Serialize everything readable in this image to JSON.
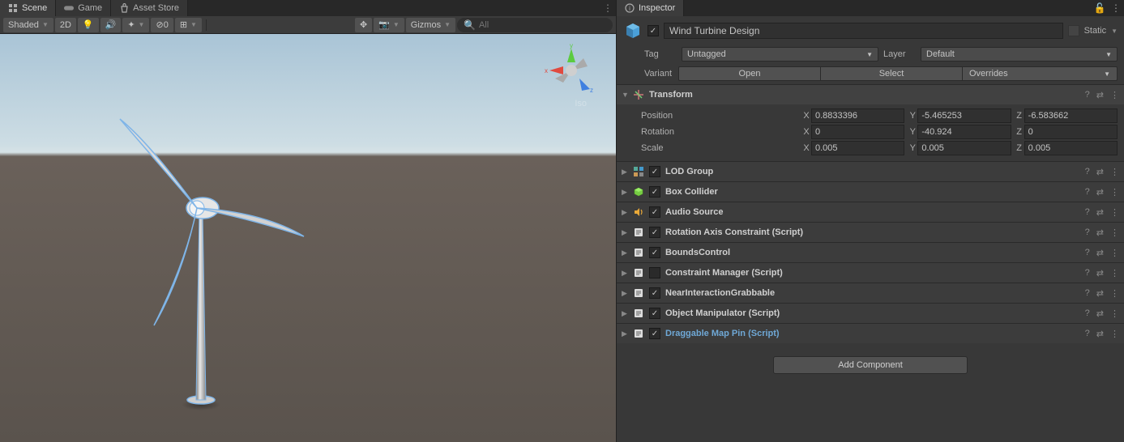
{
  "leftTabs": {
    "scene": "Scene",
    "game": "Game",
    "asset": "Asset Store"
  },
  "sceneToolbar": {
    "shaded": "Shaded",
    "twoD": "2D",
    "hiddenCount": "0",
    "gizmos": "Gizmos",
    "searchPlaceholder": "All"
  },
  "sceneView": {
    "isoLabel": "Iso",
    "axisX": "x",
    "axisY": "y",
    "axisZ": "z"
  },
  "inspector": {
    "tab": "Inspector",
    "objectName": "Wind Turbine Design",
    "staticLabel": "Static",
    "tagLabel": "Tag",
    "tagValue": "Untagged",
    "layerLabel": "Layer",
    "layerValue": "Default",
    "variantLabel": "Variant",
    "openBtn": "Open",
    "selectBtn": "Select",
    "overridesBtn": "Overrides"
  },
  "transform": {
    "title": "Transform",
    "position": {
      "label": "Position",
      "x": "0.8833396",
      "y": "-5.465253",
      "z": "-6.583662"
    },
    "rotation": {
      "label": "Rotation",
      "x": "0",
      "y": "-40.924",
      "z": "0"
    },
    "scale": {
      "label": "Scale",
      "x": "0.005",
      "y": "0.005",
      "z": "0.005"
    }
  },
  "components": [
    {
      "title": "LOD Group",
      "icon": "lod",
      "checked": true
    },
    {
      "title": "Box Collider",
      "icon": "box",
      "checked": true
    },
    {
      "title": "Audio Source",
      "icon": "audio",
      "checked": true
    },
    {
      "title": "Rotation Axis Constraint (Script)",
      "icon": "script",
      "checked": true
    },
    {
      "title": "BoundsControl",
      "icon": "script",
      "checked": true
    },
    {
      "title": "Constraint Manager (Script)",
      "icon": "script",
      "checked": false
    },
    {
      "title": "NearInteractionGrabbable",
      "icon": "script",
      "checked": true
    },
    {
      "title": "Object Manipulator (Script)",
      "icon": "script",
      "checked": true
    },
    {
      "title": "Draggable Map Pin (Script)",
      "icon": "script",
      "checked": true,
      "link": true
    }
  ],
  "addComponent": "Add Component",
  "axisLabels": {
    "x": "X",
    "y": "Y",
    "z": "Z"
  }
}
